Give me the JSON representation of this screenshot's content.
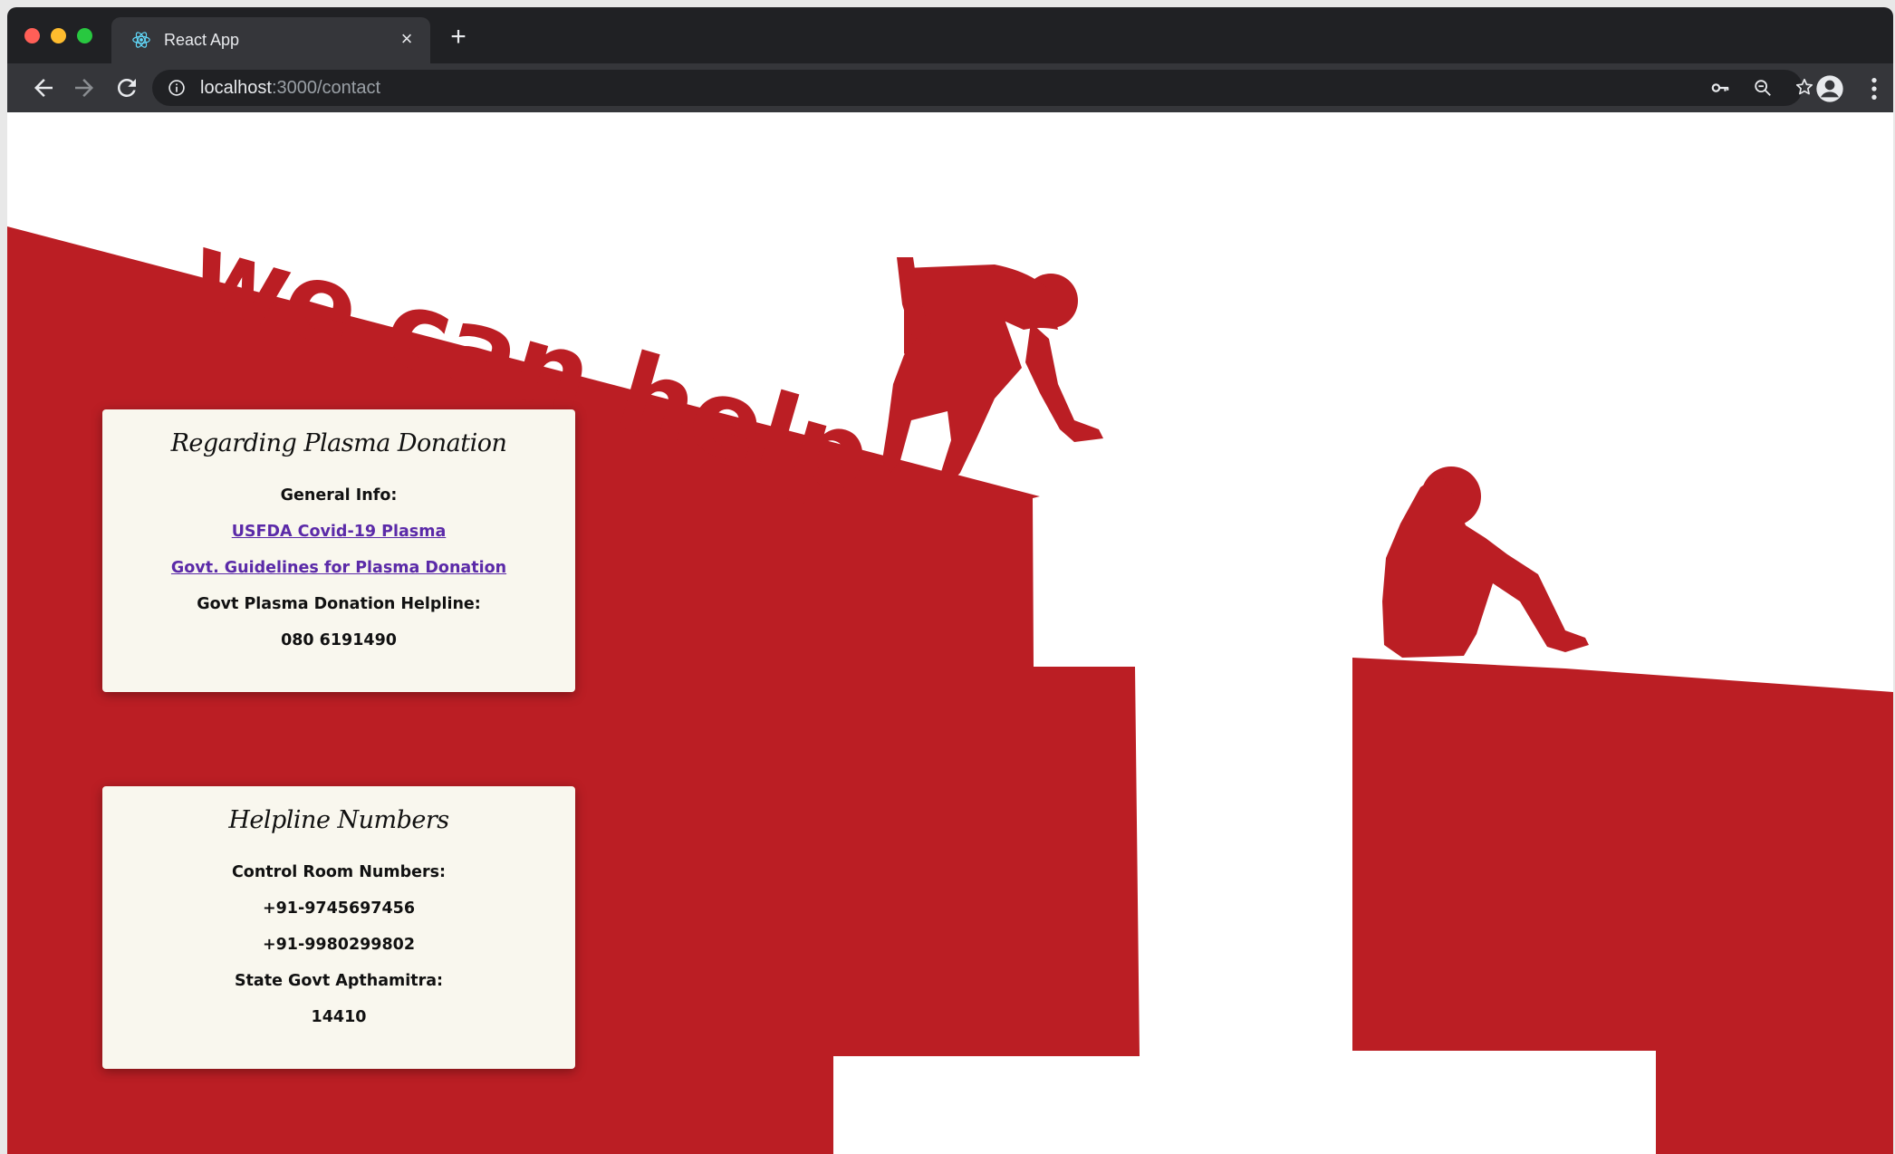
{
  "browser": {
    "tab_title": "React App",
    "new_tab_symbol": "+",
    "close_symbol": "×",
    "url_host": "localhost",
    "url_path": ":3000/contact",
    "icons": [
      "react-favicon-icon",
      "back-arrow-icon",
      "forward-arrow-icon",
      "reload-icon",
      "info-icon",
      "key-icon",
      "zoom-icon",
      "star-icon",
      "profile-icon",
      "kebab-menu-icon"
    ]
  },
  "hero": {
    "title": "we can help"
  },
  "plasma_card": {
    "title": "Regarding Plasma Donation",
    "general_info_label": "General Info:",
    "link_1": "USFDA Covid-19 Plasma",
    "link_2": "Govt. Guidelines for Plasma Donation",
    "helpline_label": "Govt Plasma Donation Helpline:",
    "helpline_number": "080 6191490"
  },
  "helpline_card": {
    "title": "Helpline Numbers",
    "control_room_label": "Control Room Numbers:",
    "number_1": "+91-9745697456",
    "number_2": "+91-9980299802",
    "apthamitra_label": "State Govt Apthamitra:",
    "apthamitra_number": "14410"
  },
  "colors": {
    "brand_red": "#bb1e24",
    "card_bg": "#f9f7ee",
    "link": "#5b2aa8",
    "chrome_dark": "#202124",
    "chrome_toolbar": "#35363a"
  }
}
